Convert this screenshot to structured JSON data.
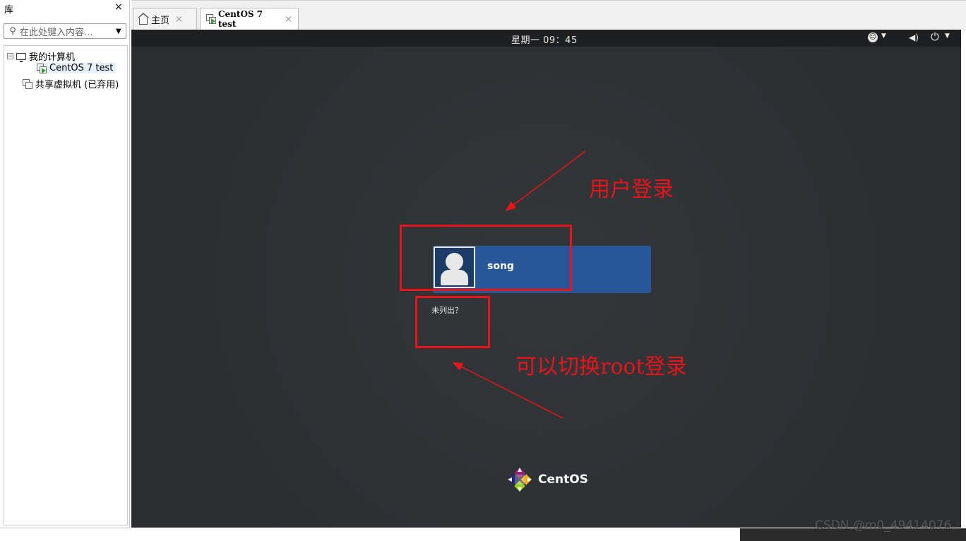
{
  "library": {
    "title": "库",
    "close_glyph": "×",
    "search_placeholder": "在此处键入内容...",
    "tree": [
      {
        "label": "我的计算机",
        "expander": "⊟"
      },
      {
        "label": "CentOS 7 test"
      },
      {
        "label": "共享虚拟机 (已弃用)"
      }
    ]
  },
  "tabs": [
    {
      "label": "主页",
      "close": "×"
    },
    {
      "label": "CentOS 7 test",
      "close": "×"
    }
  ],
  "vm": {
    "topbar": {
      "clock": "星期一 09：45"
    },
    "login": {
      "username": "song",
      "not_listed": "未列出？"
    },
    "brand": "CentOS"
  },
  "annotations": {
    "user_login": "用户登录",
    "switch_root": "可以切换root登录",
    "color": "#e8141a"
  },
  "watermark": "CSDN @m0_49414076"
}
